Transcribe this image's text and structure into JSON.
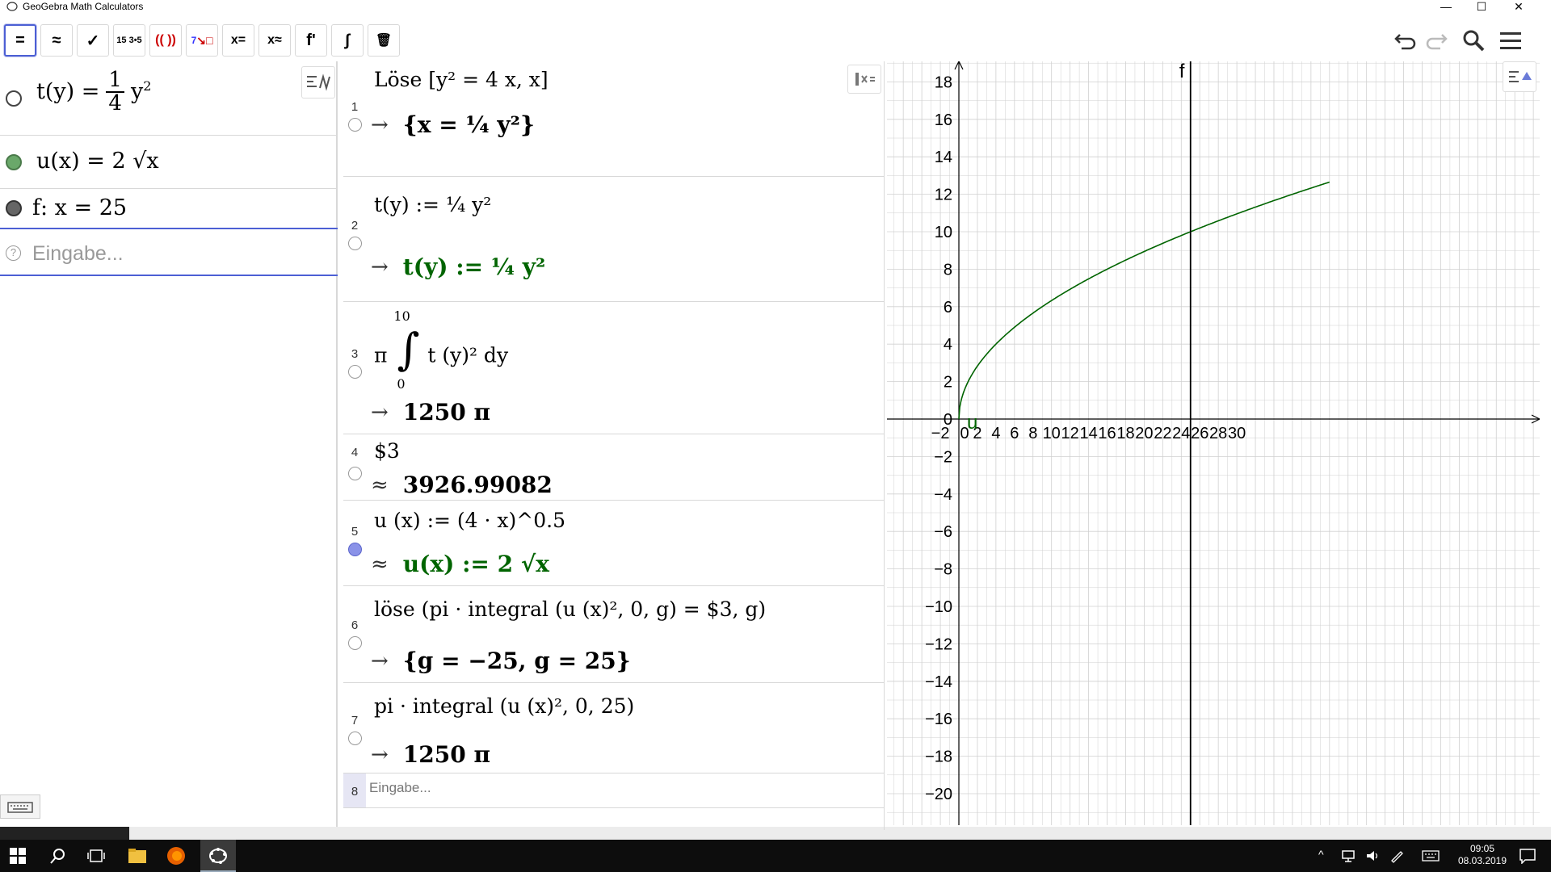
{
  "window": {
    "title": "GeoGebra Math Calculators"
  },
  "toolbar": {
    "buttons": [
      {
        "name": "eval-exact-button",
        "label": "="
      },
      {
        "name": "eval-numeric-button",
        "label": "≈"
      },
      {
        "name": "check-button",
        "label": "✓"
      },
      {
        "name": "factor-button",
        "label": "15 3•5"
      },
      {
        "name": "expand-button",
        "label": "(( ))"
      },
      {
        "name": "substitute-button",
        "label": "7"
      },
      {
        "name": "solve-button",
        "label": "x="
      },
      {
        "name": "nsolve-button",
        "label": "x≈"
      },
      {
        "name": "derivative-button",
        "label": "f'"
      },
      {
        "name": "integral-button",
        "label": "∫"
      },
      {
        "name": "delete-button",
        "label": "🗑"
      }
    ]
  },
  "algebra": {
    "rows": [
      {
        "lhs": "t(y) =",
        "num": "1",
        "den": "4",
        "rhs": "y",
        "exp": "2"
      },
      {
        "text": "u(x) = 2 √x"
      },
      {
        "text": "f: x = 25"
      }
    ],
    "input_placeholder": "Eingabe..."
  },
  "cas": {
    "rows": [
      {
        "n": "1",
        "input": "Löse [y² = 4 x, x]",
        "output": "{x = ¼ y²}"
      },
      {
        "n": "2",
        "input": "t(y) := ¼ y²",
        "output": "t(y) := ¼ y²"
      },
      {
        "n": "3",
        "input_prefix": "π",
        "int_upper": "10",
        "int_lower": "0",
        "input_body": "t (y)² dy",
        "output": "1250 π"
      },
      {
        "n": "4",
        "input": "$3",
        "output": "3926.99082"
      },
      {
        "n": "5",
        "input": "u (x) := (4 · x)^0.5",
        "output": "u(x) := 2 √x"
      },
      {
        "n": "6",
        "input": "löse (pi · integral (u (x)², 0, g) = $3, g)",
        "output": "{g = −25, g = 25}"
      },
      {
        "n": "7",
        "input": "pi · integral (u (x)², 0, 25)",
        "output": "1250 π"
      }
    ],
    "new_row": {
      "n": "8",
      "placeholder": "Eingabe..."
    }
  },
  "graph": {
    "x_ticks": [
      "−2",
      "0",
      "2",
      "4",
      "6",
      "8",
      "10",
      "12",
      "14",
      "16",
      "18",
      "20",
      "22",
      "24",
      "26",
      "28",
      "30"
    ],
    "y_ticks": [
      "18",
      "16",
      "14",
      "12",
      "10",
      "8",
      "6",
      "4",
      "2",
      "0",
      "−2",
      "−4",
      "−6",
      "−8",
      "−10",
      "−12",
      "−14",
      "−16",
      "−18",
      "−20"
    ],
    "curve_label": "u",
    "line_label": "f",
    "colors": {
      "curve": "#006400",
      "line": "#000000",
      "grid": "#d0d0d0"
    }
  },
  "taskbar": {
    "time": "09:05",
    "date": "08.03.2019"
  }
}
